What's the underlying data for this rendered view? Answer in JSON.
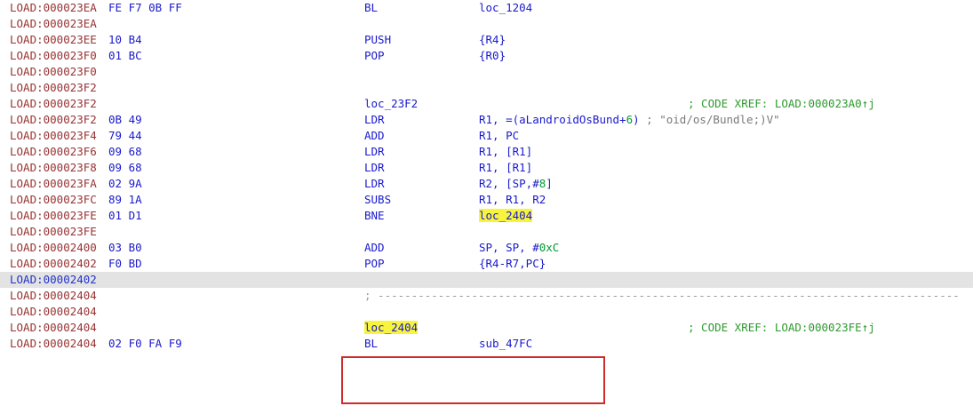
{
  "rows": [
    {
      "addr": "LOAD:000023EA",
      "bytes": "FE F7 0B FF",
      "mnem": "BL",
      "ops": "loc_1204"
    },
    {
      "addr": "LOAD:000023EA"
    },
    {
      "addr": "LOAD:000023EE",
      "bytes": "10 B4",
      "mnem": "PUSH",
      "ops": "{R4}"
    },
    {
      "addr": "LOAD:000023F0",
      "bytes": "01 BC",
      "mnem": "POP",
      "ops": "{R0}"
    },
    {
      "addr": "LOAD:000023F0"
    },
    {
      "addr": "LOAD:000023F2"
    },
    {
      "addr": "LOAD:000023F2",
      "label": "loc_23F2",
      "xref": "; CODE XREF: LOAD:000023A0↑j"
    },
    {
      "addr": "LOAD:000023F2",
      "bytes": "0B 49",
      "mnem": "LDR",
      "ops": "R1, =(aLandroidOsBund+",
      "ops_num": "6",
      "ops_tail": ")",
      "comment": " ; \"oid/os/Bundle;)V\""
    },
    {
      "addr": "LOAD:000023F4",
      "bytes": "79 44",
      "mnem": "ADD",
      "ops": "R1, PC"
    },
    {
      "addr": "LOAD:000023F6",
      "bytes": "09 68",
      "mnem": "LDR",
      "ops": "R1, [R1]"
    },
    {
      "addr": "LOAD:000023F8",
      "bytes": "09 68",
      "mnem": "LDR",
      "ops": "R1, [R1]"
    },
    {
      "addr": "LOAD:000023FA",
      "bytes": "02 9A",
      "mnem": "LDR",
      "ops": "R2, [SP,#",
      "ops_num": "8",
      "ops_tail": "]"
    },
    {
      "addr": "LOAD:000023FC",
      "bytes": "89 1A",
      "mnem": "SUBS",
      "ops": "R1, R1, R2"
    },
    {
      "addr": "LOAD:000023FE",
      "bytes": "01 D1",
      "mnem": "BNE",
      "ops_hl": "loc_2404"
    },
    {
      "addr": "LOAD:000023FE"
    },
    {
      "addr": "LOAD:00002400",
      "bytes": "03 B0",
      "mnem": "ADD",
      "ops": "SP, SP, #",
      "ops_num": "0xC"
    },
    {
      "addr": "LOAD:00002402",
      "bytes": "F0 BD",
      "mnem": "POP",
      "ops": "{R4-R7,PC}"
    },
    {
      "addr": "LOAD:00002402",
      "current": true
    },
    {
      "addr": "LOAD:00002404",
      "separator": "; ---------------------------------------------------------------------------------------"
    },
    {
      "addr": "LOAD:00002404"
    },
    {
      "addr": "LOAD:00002404",
      "label_hl": "loc_2404",
      "xref": "; CODE XREF: LOAD:000023FE↑j"
    },
    {
      "addr": "LOAD:00002404",
      "bytes": "02 F0 FA F9",
      "mnem": "BL",
      "ops": "sub_47FC"
    }
  ],
  "colors": {
    "address": "#993333",
    "current_address": "#2233cc",
    "instruction": "#1a1acc",
    "immediate": "#009933",
    "xref_comment": "#2e9a2e",
    "string_comment": "#7a7a7a",
    "highlight": "#f7f43d",
    "current_line_bg": "#e3e3e3",
    "selection_box": "#d02b2b"
  }
}
